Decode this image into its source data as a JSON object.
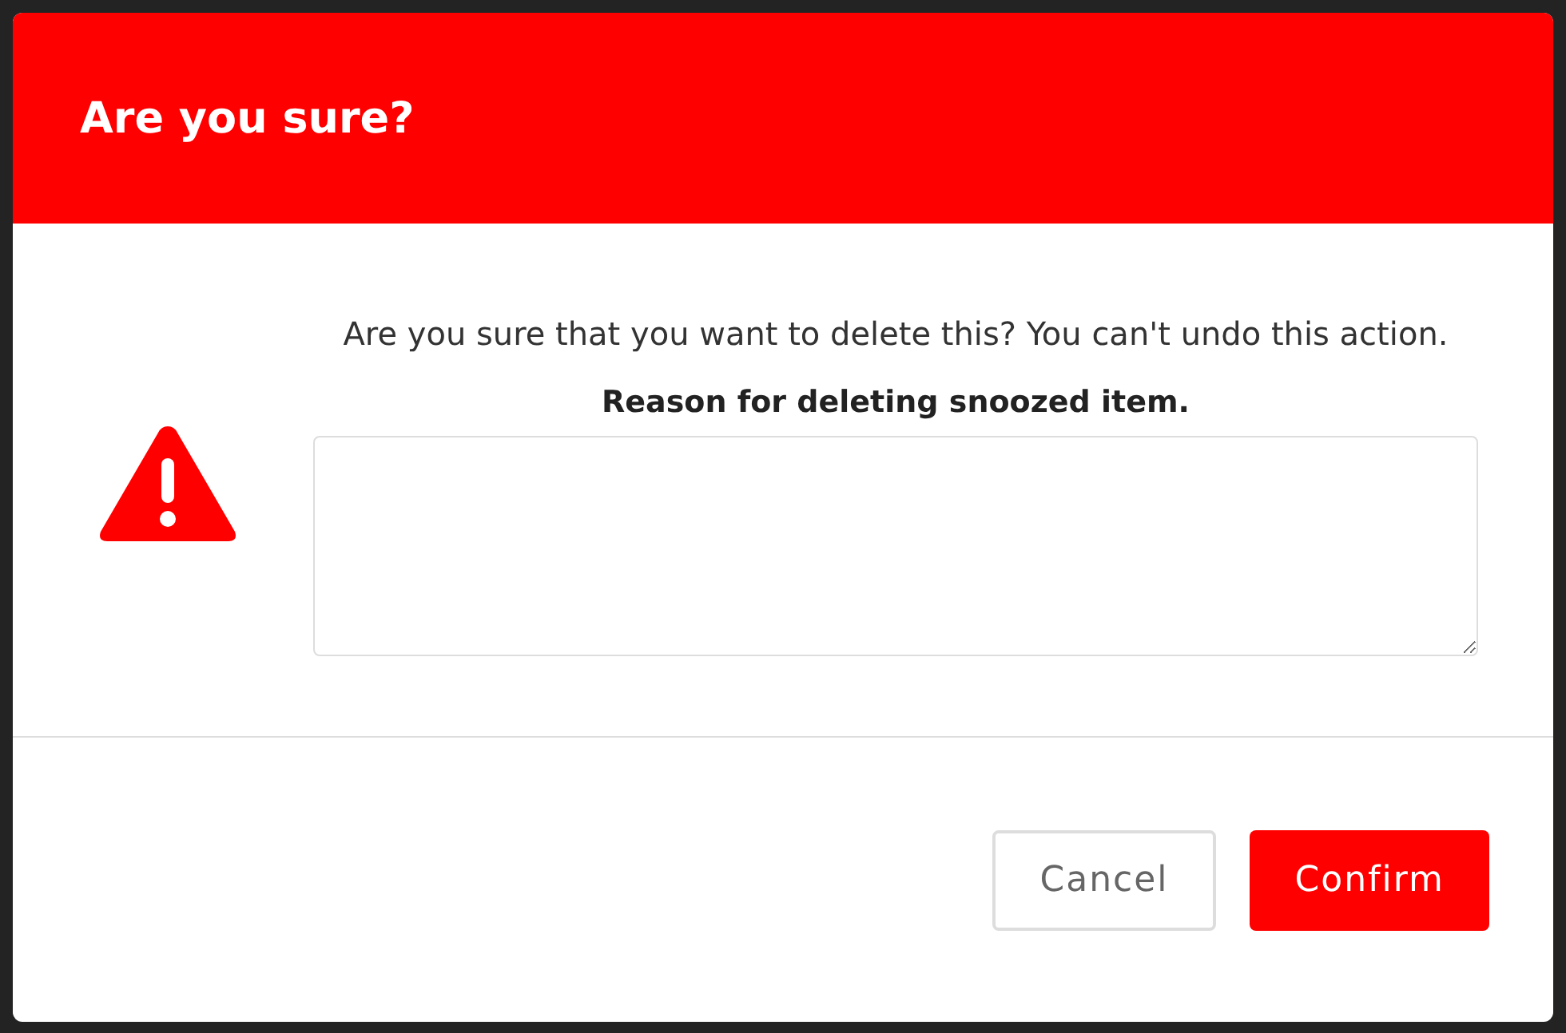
{
  "dialog": {
    "title": "Are you sure?",
    "message": "Are you sure that you want to delete this? You can't undo this action.",
    "field_label": "Reason for deleting snoozed item.",
    "buttons": [
      {
        "label": "Cancel",
        "kind": "secondary"
      },
      {
        "label": "Confirm",
        "kind": "primary"
      }
    ]
  }
}
